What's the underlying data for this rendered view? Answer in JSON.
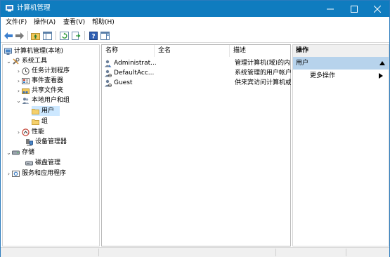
{
  "window": {
    "title": "计算机管理"
  },
  "menu": [
    "文件(F)",
    "操作(A)",
    "查看(V)",
    "帮助(H)"
  ],
  "tree": [
    {
      "label": "计算机管理(本地)",
      "icon": "computer-management-icon",
      "expander": ""
    },
    {
      "label": "系统工具",
      "icon": "tools-icon",
      "expander": "expanded"
    },
    {
      "label": "任务计划程序",
      "icon": "clock-icon",
      "expander": "collapsed"
    },
    {
      "label": "事件查看器",
      "icon": "event-viewer-icon",
      "expander": "collapsed"
    },
    {
      "label": "共享文件夹",
      "icon": "shared-folder-icon",
      "expander": "collapsed"
    },
    {
      "label": "本地用户和组",
      "icon": "users-icon",
      "expander": "expanded"
    },
    {
      "label": "用户",
      "icon": "folder-icon",
      "expander": "",
      "selected": true
    },
    {
      "label": "组",
      "icon": "folder-icon",
      "expander": ""
    },
    {
      "label": "性能",
      "icon": "performance-icon",
      "expander": "collapsed"
    },
    {
      "label": "设备管理器",
      "icon": "device-manager-icon",
      "expander": ""
    },
    {
      "label": "存储",
      "icon": "storage-icon",
      "expander": "expanded"
    },
    {
      "label": "磁盘管理",
      "icon": "disk-icon",
      "expander": ""
    },
    {
      "label": "服务和应用程序",
      "icon": "services-icon",
      "expander": "collapsed"
    }
  ],
  "list": {
    "columns": [
      "名称",
      "全名",
      "描述"
    ],
    "rows": [
      {
        "name": "Administrat...",
        "fullname": "",
        "desc": "管理计算机(域)的内"
      },
      {
        "name": "DefaultAcc...",
        "fullname": "",
        "desc": "系统管理的用户帐户"
      },
      {
        "name": "Guest",
        "fullname": "",
        "desc": "供来宾访问计算机或"
      }
    ]
  },
  "actions": {
    "header": "操作",
    "section": "用户",
    "more": "更多操作"
  },
  "colors": {
    "titlebar": "#0f7cbf",
    "selection": "#cde8ff",
    "action_section": "#b7d3ec"
  }
}
